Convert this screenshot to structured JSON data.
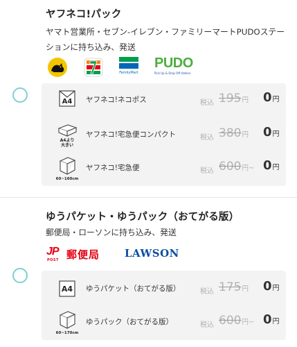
{
  "yamato": {
    "title": "ヤフネコ!パック",
    "description": "ヤマト営業所・セブン-イレブン・ファミリーマートPUDOステーションに持ち込み、発送",
    "logos": {
      "familymart_text": "FamilyMart",
      "pudo_text": "PUDO",
      "pudo_sub": "Pick Up & Drop Off station"
    },
    "rows": [
      {
        "icon_label": "A4",
        "icon_caption": "",
        "name": "ヤフネコ!ネコポス",
        "tax": "税込",
        "old_price": "195",
        "yen": "円",
        "tilde": "",
        "new_price": "0",
        "new_yen": "円"
      },
      {
        "icon_label": "",
        "icon_caption": "A4より\n大きい",
        "name": "ヤフネコ!宅急便コンパクト",
        "tax": "税込",
        "old_price": "380",
        "yen": "円",
        "tilde": "",
        "new_price": "0",
        "new_yen": "円"
      },
      {
        "icon_label": "",
        "icon_caption": "60~160cm",
        "name": "ヤフネコ!宅急便",
        "tax": "税込",
        "old_price": "600",
        "yen": "円",
        "tilde": "~",
        "new_price": "0",
        "new_yen": "円"
      }
    ]
  },
  "yubin": {
    "title": "ゆうパケット・ゆうパック（おてがる版）",
    "description": "郵便局・ローソンに持ち込み、発送",
    "logos": {
      "jp_text": "JP",
      "post_text": "POST",
      "yubinkyoku_text": "郵便局",
      "lawson_text": "LAWSON"
    },
    "rows": [
      {
        "icon_label": "A4",
        "icon_caption": "",
        "name": "ゆうパケット（おてがる版）",
        "tax": "税込",
        "old_price": "175",
        "yen": "円",
        "tilde": "",
        "new_price": "0",
        "new_yen": "円"
      },
      {
        "icon_label": "",
        "icon_caption": "60~170cm",
        "name": "ゆうパック（おてがる版）",
        "tax": "税込",
        "old_price": "600",
        "yen": "円",
        "tilde": "~",
        "new_price": "0",
        "new_yen": "円"
      }
    ]
  },
  "colors": {
    "radio_border": "#7fcfd4",
    "familymart_green": "#009e4f",
    "familymart_blue": "#0068b7",
    "pudo_green": "#4cae3e",
    "pudo_blue": "#1d4fa0",
    "japanpost_red": "#e60012",
    "lawson_blue": "#0b4ea2"
  }
}
